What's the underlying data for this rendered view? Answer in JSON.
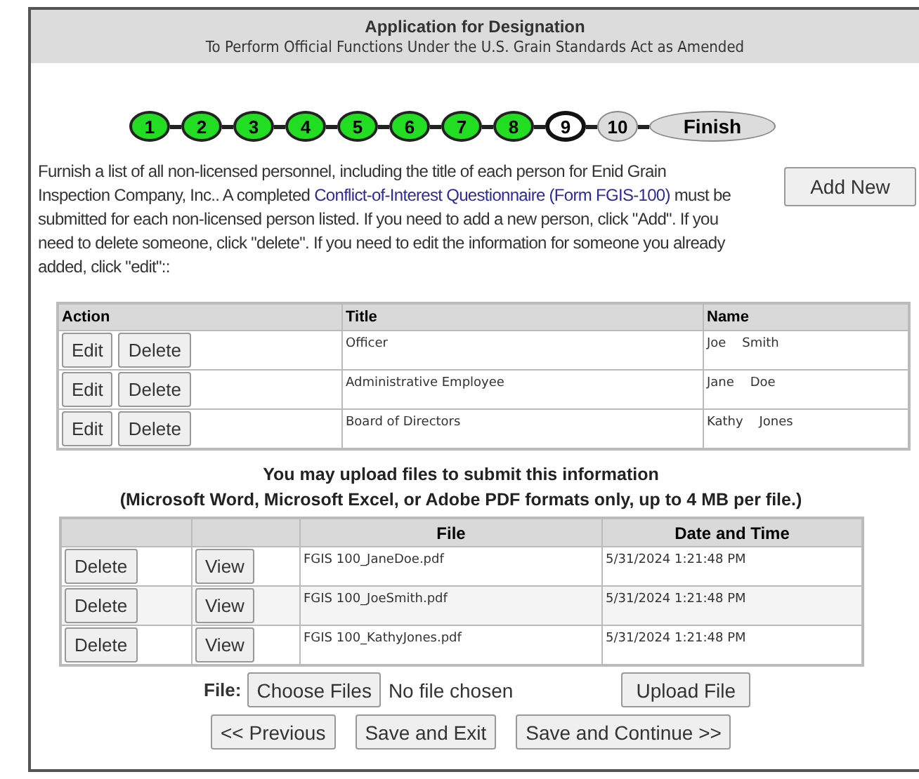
{
  "header": {
    "title": "Application for Designation",
    "subtitle": "To Perform Official Functions Under the U.S. Grain Standards Act as Amended"
  },
  "steps": [
    {
      "label": "1",
      "kind": "circle",
      "completed": true,
      "selected": false
    },
    {
      "label": "2",
      "kind": "circle",
      "completed": true,
      "selected": false
    },
    {
      "label": "3",
      "kind": "circle",
      "completed": true,
      "selected": false
    },
    {
      "label": "4",
      "kind": "circle",
      "completed": true,
      "selected": false
    },
    {
      "label": "5",
      "kind": "circle",
      "completed": true,
      "selected": false
    },
    {
      "label": "6",
      "kind": "circle",
      "completed": true,
      "selected": false
    },
    {
      "label": "7",
      "kind": "circle",
      "completed": true,
      "selected": false
    },
    {
      "label": "8",
      "kind": "circle",
      "completed": true,
      "selected": false
    },
    {
      "label": "9",
      "kind": "circle",
      "completed": false,
      "selected": true
    },
    {
      "label": "10",
      "kind": "circle",
      "completed": false,
      "selected": false
    },
    {
      "label": "Finish",
      "kind": "oval",
      "completed": false,
      "selected": false
    }
  ],
  "instructions": {
    "before": "Furnish a list of all non-licensed personnel, including the title of each person for Enid Grain Inspection Company, Inc.. A completed ",
    "link": "Conflict-of-Interest Questionnaire (Form FGIS-100)",
    "after": " must be submitted for each non-licensed person listed. If you need to add a new person, click \"Add\". If you need to delete someone, click \"delete\". If you need to edit the information for someone you already added, click \"edit\"::"
  },
  "add_button": "Add New",
  "personnel": {
    "columns": [
      "Action",
      "Title",
      "Name"
    ],
    "rows": [
      {
        "edit": "Edit",
        "delete": "Delete",
        "title": "Officer",
        "name": "Joe    Smith"
      },
      {
        "edit": "Edit",
        "delete": "Delete",
        "title": "Administrative Employee",
        "name": "Jane    Doe"
      },
      {
        "edit": "Edit",
        "delete": "Delete",
        "title": "Board of Directors",
        "name": "Kathy    Jones"
      }
    ]
  },
  "upload_note": [
    "You may upload files to submit this information",
    "(Microsoft Word, Microsoft Excel, or Adobe PDF formats only, up to 4 MB per file.)"
  ],
  "files": {
    "columns": [
      "File",
      "Date and Time"
    ],
    "rows": [
      {
        "delete": "Delete",
        "view": "View",
        "file": "FGIS 100_JaneDoe.pdf",
        "date": "5/31/2024 1:21:48 PM"
      },
      {
        "delete": "Delete",
        "view": "View",
        "file": "FGIS 100_JoeSmith.pdf",
        "date": "5/31/2024 1:21:48 PM"
      },
      {
        "delete": "Delete",
        "view": "View",
        "file": "FGIS 100_KathyJones.pdf",
        "date": "5/31/2024 1:21:48 PM"
      }
    ]
  },
  "file_input": {
    "label": "File:",
    "button": "Choose Files",
    "status": "No file chosen"
  },
  "upload_button": "Upload File",
  "nav_buttons": [
    "<< Previous",
    "Save and Exit",
    "Save and Continue >>"
  ]
}
